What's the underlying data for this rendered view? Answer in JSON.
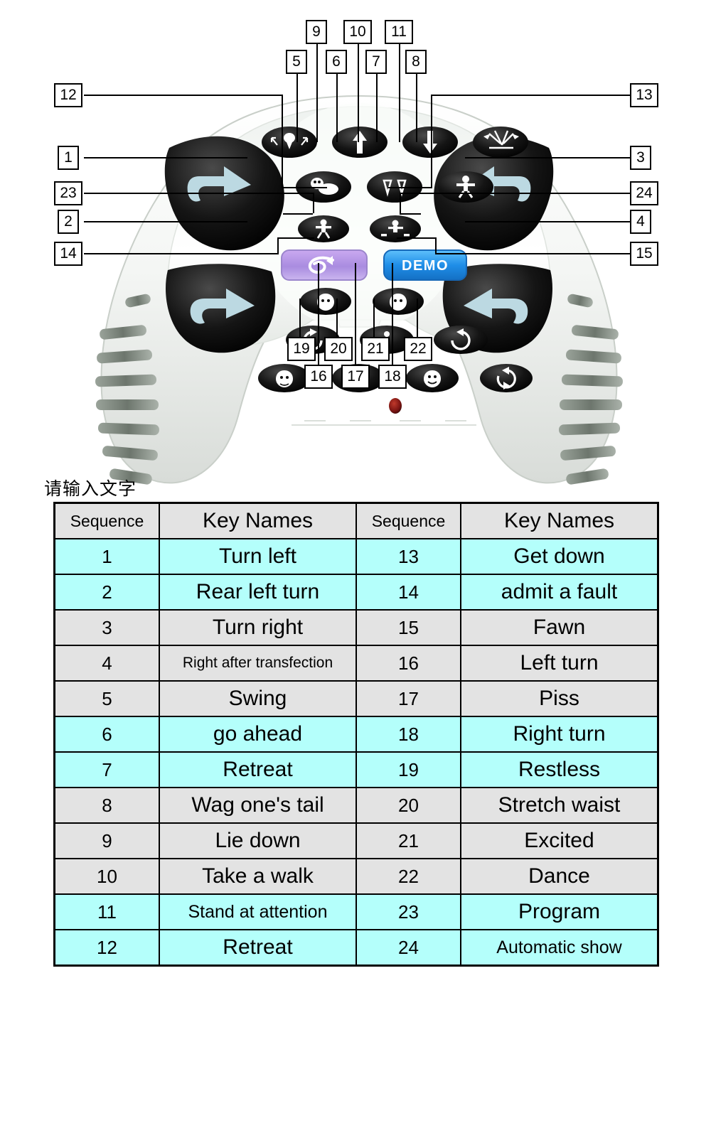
{
  "caption": "请输入文字",
  "colors": {
    "row_cyan": "#b4fffb",
    "row_gray": "#e3e3e3",
    "header_gray": "#e3e3e3",
    "demo_blue": "#2a9df4",
    "program_purple": "#b39ddb",
    "led_red": "#8b1a1a",
    "border_black": "#000000"
  },
  "device": {
    "name": "robot-dog-remote-control",
    "demo_button_label": "DEMO",
    "program_button_icon": "loop-icon",
    "led_indicator": "power-led"
  },
  "callouts": [
    {
      "id": "5",
      "label": "5"
    },
    {
      "id": "6",
      "label": "6"
    },
    {
      "id": "7",
      "label": "7"
    },
    {
      "id": "8",
      "label": "8"
    },
    {
      "id": "9",
      "label": "9"
    },
    {
      "id": "10",
      "label": "10"
    },
    {
      "id": "11",
      "label": "11"
    },
    {
      "id": "12",
      "label": "12"
    },
    {
      "id": "13",
      "label": "13"
    },
    {
      "id": "1",
      "label": "1"
    },
    {
      "id": "3",
      "label": "3"
    },
    {
      "id": "23",
      "label": "23"
    },
    {
      "id": "24",
      "label": "24"
    },
    {
      "id": "2",
      "label": "2"
    },
    {
      "id": "4",
      "label": "4"
    },
    {
      "id": "14",
      "label": "14"
    },
    {
      "id": "15",
      "label": "15"
    },
    {
      "id": "19",
      "label": "19"
    },
    {
      "id": "20",
      "label": "20"
    },
    {
      "id": "21",
      "label": "21"
    },
    {
      "id": "22",
      "label": "22"
    },
    {
      "id": "16",
      "label": "16"
    },
    {
      "id": "17",
      "label": "17"
    },
    {
      "id": "18",
      "label": "18"
    }
  ],
  "table": {
    "headers": {
      "sequence_left": "Sequence",
      "keynames_left": "Key Names",
      "sequence_right": "Sequence",
      "keynames_right": "Key Names"
    },
    "rows": [
      {
        "left_seq": "1",
        "left_name": "Turn left",
        "left_fill": "cyan",
        "right_seq": "13",
        "right_name": "Get down",
        "right_fill": "cyan"
      },
      {
        "left_seq": "2",
        "left_name": "Rear left turn",
        "left_fill": "cyan",
        "right_seq": "14",
        "right_name": "admit a fault",
        "right_fill": "cyan"
      },
      {
        "left_seq": "3",
        "left_name": "Turn right",
        "left_fill": "gray",
        "right_seq": "15",
        "right_name": "Fawn",
        "right_fill": "gray"
      },
      {
        "left_seq": "4",
        "left_name": "Right after transfection",
        "left_fill": "gray",
        "right_seq": "16",
        "right_name": "Left turn",
        "right_fill": "gray"
      },
      {
        "left_seq": "5",
        "left_name": "Swing",
        "left_fill": "gray",
        "right_seq": "17",
        "right_name": "Piss",
        "right_fill": "gray"
      },
      {
        "left_seq": "6",
        "left_name": "go ahead",
        "left_fill": "cyan",
        "right_seq": "18",
        "right_name": "Right turn",
        "right_fill": "cyan"
      },
      {
        "left_seq": "7",
        "left_name": "Retreat",
        "left_fill": "cyan",
        "right_seq": "19",
        "right_name": "Restless",
        "right_fill": "cyan"
      },
      {
        "left_seq": "8",
        "left_name": "Wag one's tail",
        "left_fill": "gray",
        "right_seq": "20",
        "right_name": "Stretch waist",
        "right_fill": "gray"
      },
      {
        "left_seq": "9",
        "left_name": "Lie down",
        "left_fill": "gray",
        "right_seq": "21",
        "right_name": "Excited",
        "right_fill": "gray"
      },
      {
        "left_seq": "10",
        "left_name": "Take a walk",
        "left_fill": "gray",
        "right_seq": "22",
        "right_name": "Dance",
        "right_fill": "gray"
      },
      {
        "left_seq": "11",
        "left_name": "Stand at attention",
        "left_fill": "cyan",
        "right_seq": "23",
        "right_name": "Program",
        "right_fill": "cyan"
      },
      {
        "left_seq": "12",
        "left_name": "Retreat",
        "left_fill": "cyan",
        "right_seq": "24",
        "right_name": "Automatic show",
        "right_fill": "cyan"
      }
    ]
  }
}
